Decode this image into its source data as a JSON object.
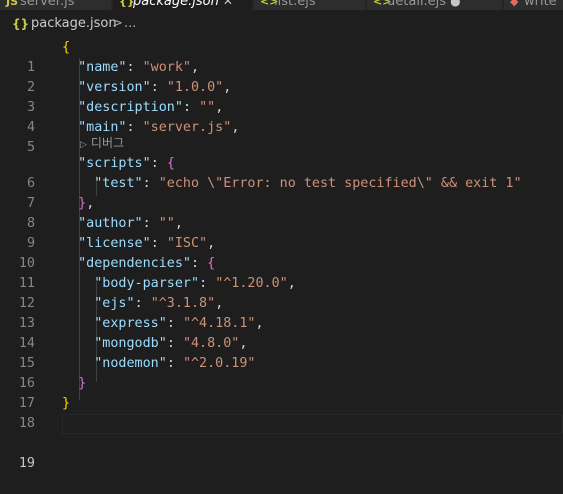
{
  "tabs": [
    {
      "label": "server.js",
      "icon": "js-file-icon"
    },
    {
      "label": "package.json",
      "icon": "json-file-icon",
      "active": true
    },
    {
      "label": "list.ejs",
      "icon": "ejs-file-icon"
    },
    {
      "label": "detail.ejs",
      "icon": "ejs-file-icon"
    },
    {
      "label": "write",
      "icon": "git-file-icon"
    }
  ],
  "breadcrumb": {
    "icon_text": "{}",
    "file": "package.json",
    "separator": ">",
    "more": "..."
  },
  "codelens": {
    "label": "디버그"
  },
  "gutter": [
    "1",
    "2",
    "3",
    "4",
    "5",
    "6",
    "7",
    "8",
    "9",
    "10",
    "11",
    "12",
    "13",
    "14",
    "15",
    "16",
    "17",
    "18",
    "19"
  ],
  "code": {
    "l1": {
      "brace": "{"
    },
    "l2": {
      "key": "\"name\"",
      "colon": ": ",
      "val": "\"work\"",
      "comma": ","
    },
    "l3": {
      "key": "\"version\"",
      "colon": ": ",
      "val": "\"1.0.0\"",
      "comma": ","
    },
    "l4": {
      "key": "\"description\"",
      "colon": ": ",
      "val": "\"\"",
      "comma": ","
    },
    "l5": {
      "key": "\"main\"",
      "colon": ": ",
      "val": "\"server.js\"",
      "comma": ","
    },
    "l6": {
      "key": "\"scripts\"",
      "colon": ": ",
      "brace": "{"
    },
    "l7": {
      "key": "\"test\"",
      "colon": ": ",
      "val": "\"echo \\\"Error: no test specified\\\" && exit 1\""
    },
    "l8": {
      "brace": "}",
      "comma": ","
    },
    "l9": {
      "key": "\"author\"",
      "colon": ": ",
      "val": "\"\"",
      "comma": ","
    },
    "l10": {
      "key": "\"license\"",
      "colon": ": ",
      "val": "\"ISC\"",
      "comma": ","
    },
    "l11": {
      "key": "\"dependencies\"",
      "colon": ": ",
      "brace": "{"
    },
    "l12": {
      "key": "\"body-parser\"",
      "colon": ": ",
      "val": "\"^1.20.0\"",
      "comma": ","
    },
    "l13": {
      "key": "\"ejs\"",
      "colon": ": ",
      "val": "\"^3.1.8\"",
      "comma": ","
    },
    "l14": {
      "key": "\"express\"",
      "colon": ": ",
      "val": "\"^4.18.1\"",
      "comma": ","
    },
    "l15": {
      "key": "\"mongodb\"",
      "colon": ": ",
      "val": "\"4.8.0\"",
      "comma": ","
    },
    "l16": {
      "key": "\"nodemon\"",
      "colon": ": ",
      "val": "\"^2.0.19\""
    },
    "l17": {
      "brace": "}"
    },
    "l18": {
      "brace": "}"
    }
  },
  "colors": {
    "background": "#1e1e1e",
    "key": "#9cdcfe",
    "string": "#ce9178",
    "bracket_level1": "#ffd700",
    "bracket_level2": "#da70d6",
    "bracket_level3": "#179fff"
  }
}
